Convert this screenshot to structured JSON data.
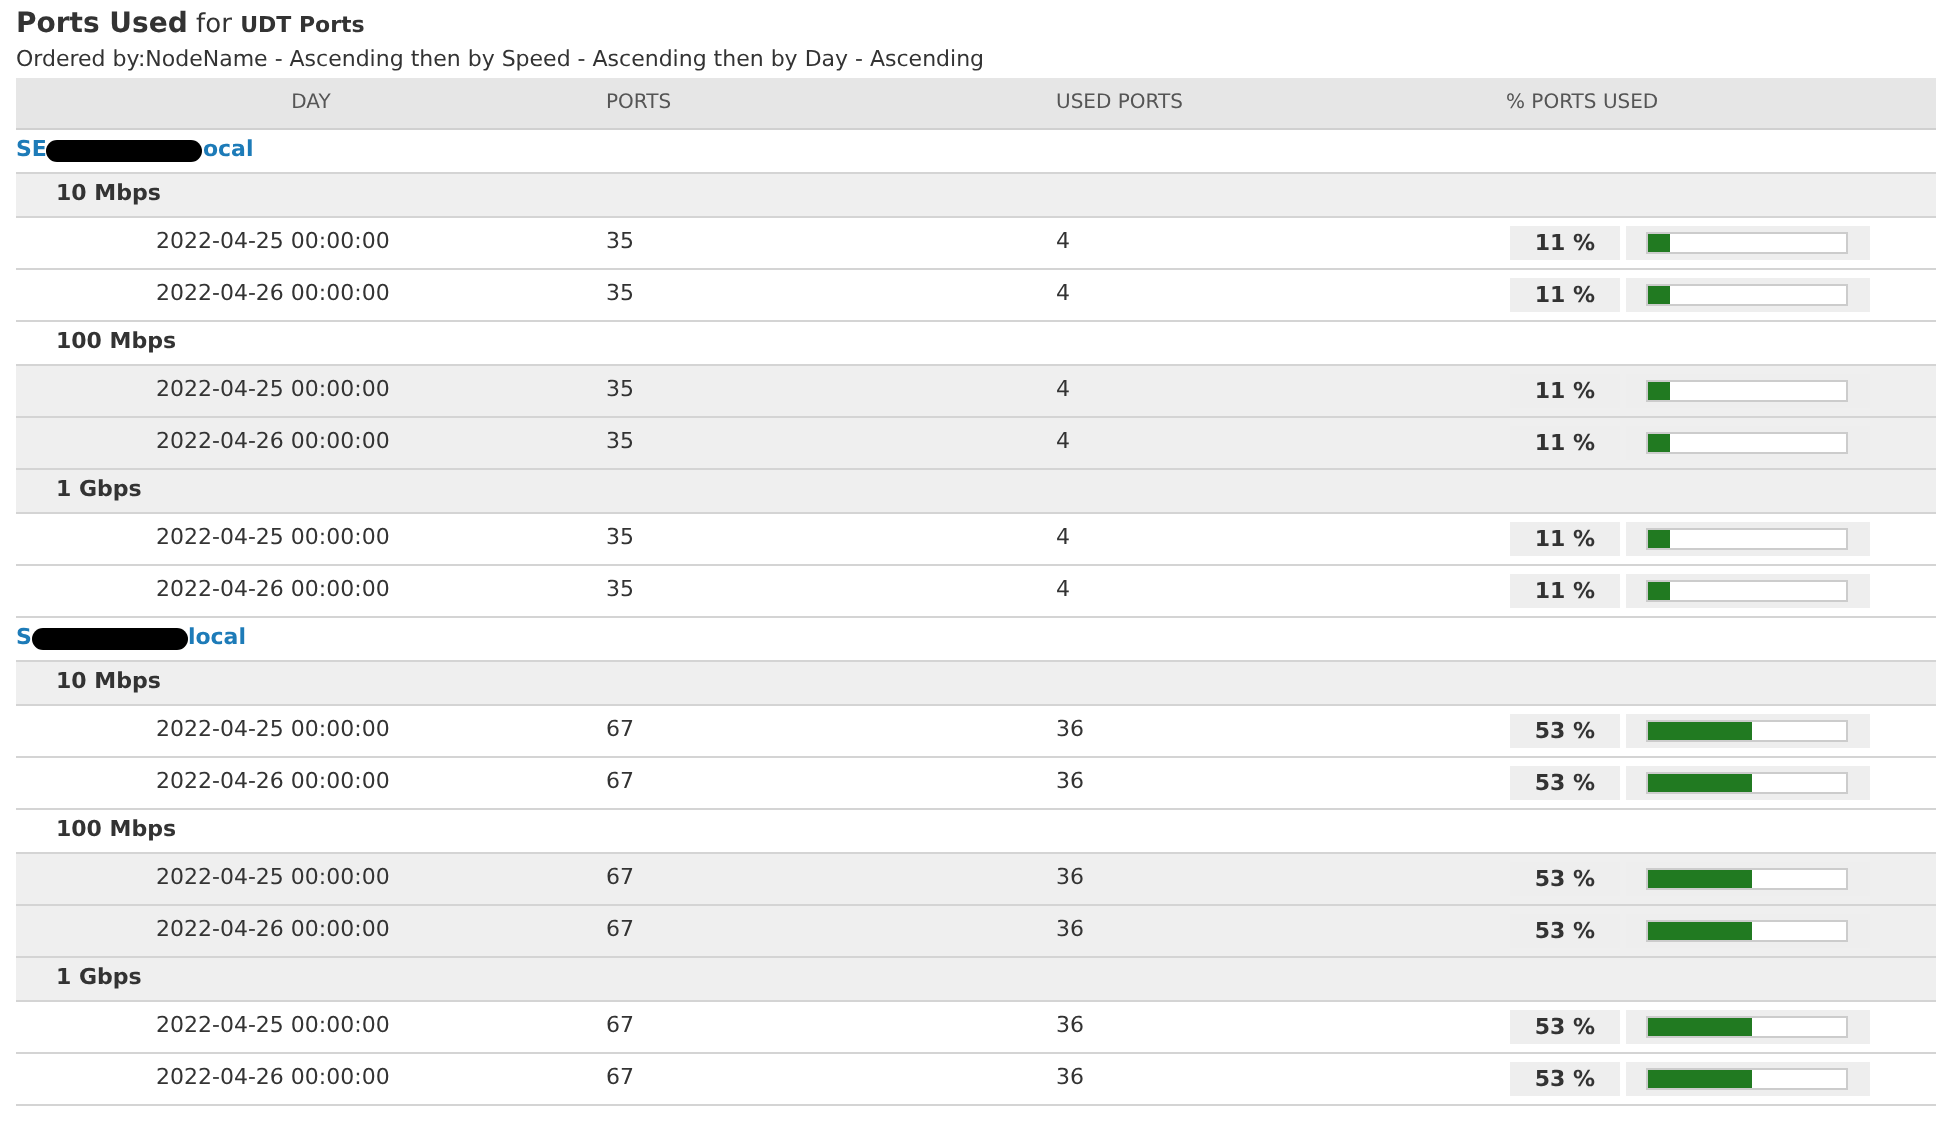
{
  "title": {
    "main": "Ports Used",
    "connector": "for",
    "subject": "UDT Ports"
  },
  "ordering": "Ordered by:NodeName - Ascending then by Speed - Ascending then by Day - Ascending",
  "table": {
    "columns": [
      "DAY",
      "PORTS",
      "USED PORTS",
      "% PORTS USED"
    ],
    "nodes": [
      {
        "name_start": "SE",
        "name_end": "ocal",
        "redacted": true,
        "speeds": [
          {
            "speed": "10 Mbps",
            "rows": [
              {
                "day": "2022-04-25 00:00:00",
                "ports": "35",
                "used": "4",
                "percent": "11 %",
                "level": 0.11
              },
              {
                "day": "2022-04-26 00:00:00",
                "ports": "35",
                "used": "4",
                "percent": "11 %",
                "level": 0.11
              }
            ]
          },
          {
            "speed": "100 Mbps",
            "rows": [
              {
                "day": "2022-04-25 00:00:00",
                "ports": "35",
                "used": "4",
                "percent": "11 %",
                "level": 0.11
              },
              {
                "day": "2022-04-26 00:00:00",
                "ports": "35",
                "used": "4",
                "percent": "11 %",
                "level": 0.11
              }
            ]
          },
          {
            "speed": "1 Gbps",
            "rows": [
              {
                "day": "2022-04-25 00:00:00",
                "ports": "35",
                "used": "4",
                "percent": "11 %",
                "level": 0.11
              },
              {
                "day": "2022-04-26 00:00:00",
                "ports": "35",
                "used": "4",
                "percent": "11 %",
                "level": 0.11
              }
            ]
          }
        ]
      },
      {
        "name_start": "S",
        "name_end": "local",
        "redacted": true,
        "speeds": [
          {
            "speed": "10 Mbps",
            "rows": [
              {
                "day": "2022-04-25 00:00:00",
                "ports": "67",
                "used": "36",
                "percent": "53 %",
                "level": 0.53
              },
              {
                "day": "2022-04-26 00:00:00",
                "ports": "67",
                "used": "36",
                "percent": "53 %",
                "level": 0.53
              }
            ]
          },
          {
            "speed": "100 Mbps",
            "rows": [
              {
                "day": "2022-04-25 00:00:00",
                "ports": "67",
                "used": "36",
                "percent": "53 %",
                "level": 0.53
              },
              {
                "day": "2022-04-26 00:00:00",
                "ports": "67",
                "used": "36",
                "percent": "53 %",
                "level": 0.53
              }
            ]
          },
          {
            "speed": "1 Gbps",
            "rows": [
              {
                "day": "2022-04-25 00:00:00",
                "ports": "67",
                "used": "36",
                "percent": "53 %",
                "level": 0.53
              },
              {
                "day": "2022-04-26 00:00:00",
                "ports": "67",
                "used": "36",
                "percent": "53 %",
                "level": 0.53
              }
            ]
          }
        ]
      }
    ]
  }
}
